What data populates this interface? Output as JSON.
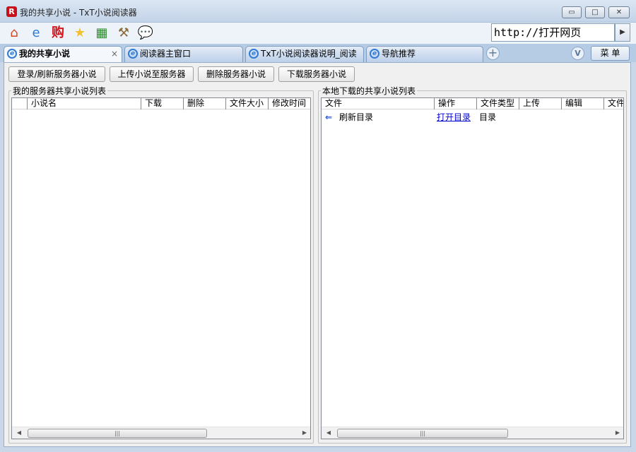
{
  "window": {
    "title": "我的共享小说 - TxT小说阅读器",
    "app_icon_letter": "R",
    "minimize_glyph": "▭",
    "maximize_glyph": "□",
    "close_glyph": "✕"
  },
  "toolbar": {
    "icons": [
      {
        "name": "home-icon",
        "glyph": "⌂",
        "color": "#d9431f"
      },
      {
        "name": "ie-browser-icon",
        "glyph": "e",
        "color": "#2f7bd6"
      },
      {
        "name": "shop-icon",
        "glyph": "购",
        "color": "#d2141b"
      },
      {
        "name": "favorites-star-icon",
        "glyph": "★",
        "color": "#f2c12e"
      },
      {
        "name": "game-icon",
        "glyph": "▦",
        "color": "#2e8b2e"
      },
      {
        "name": "tools-icon",
        "glyph": "⚒",
        "color": "#8a6d3b"
      },
      {
        "name": "chat-bubble-icon",
        "glyph": "💬",
        "color": "#f0a818"
      }
    ],
    "url_value": "http://打开网页",
    "go_glyph": "▶"
  },
  "tabs": [
    {
      "label": "我的共享小说",
      "active": true,
      "close": "×"
    },
    {
      "label": "阅读器主窗口",
      "active": false
    },
    {
      "label": "TxT小说阅读器说明_阅读",
      "active": false
    },
    {
      "label": "导航推荐",
      "active": false
    }
  ],
  "tab_controls": {
    "add": "+",
    "dropdown": "V",
    "menu": "菜 单"
  },
  "actions": {
    "login_refresh": "登录/刷新服务器小说",
    "upload": "上传小说至服务器",
    "delete": "删除服务器小说",
    "download": "下载服务器小说"
  },
  "server_panel": {
    "title": "我的服务器共享小说列表",
    "columns": [
      "",
      "小说名",
      "下载",
      "删除",
      "文件大小",
      "修改时间"
    ],
    "rows": []
  },
  "local_panel": {
    "title": "本地下载的共享小说列表",
    "columns": [
      "文件",
      "操作",
      "文件类型",
      "上传",
      "编辑",
      "文件"
    ],
    "rows": [
      {
        "icon": "back-arrow-icon",
        "glyph": "⇐",
        "file": "刷新目录",
        "action": "打开目录",
        "type": "目录"
      }
    ]
  },
  "scrollbar": {
    "left": "◀",
    "right": "▶",
    "grip": "|||"
  },
  "colors": {
    "accent": "#2f7bd6",
    "brand_red": "#c8101a",
    "link": "#0000cc"
  }
}
